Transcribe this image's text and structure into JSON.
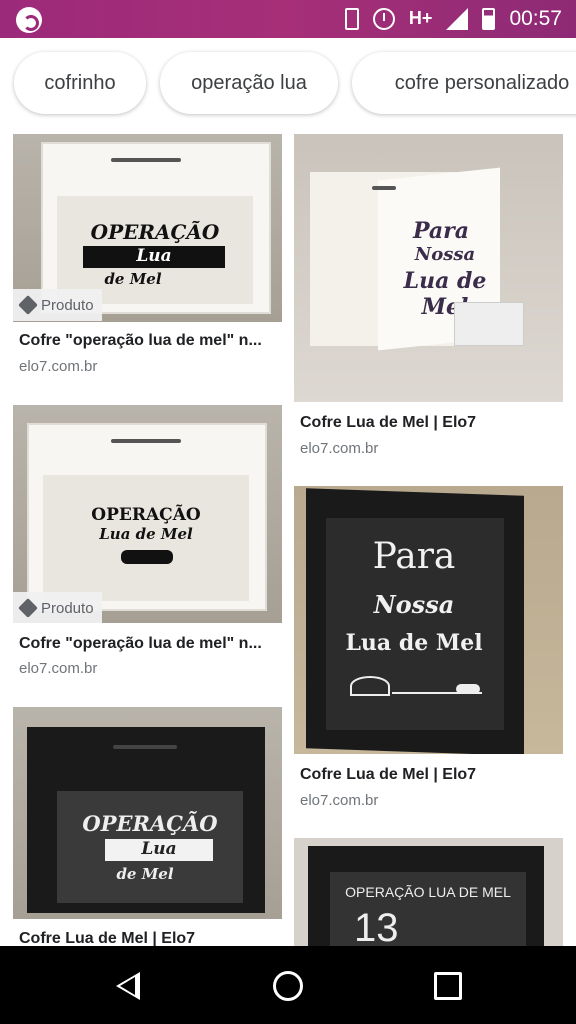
{
  "status_bar": {
    "network": "H+",
    "time": "00:57"
  },
  "chips": [
    "cofrinho",
    "operação lua",
    "cofre personalizado"
  ],
  "results": {
    "left": [
      {
        "caption": "Cofre \"operação lua de mel\" n...",
        "source": "elo7.com.br",
        "badge": "Produto",
        "art": {
          "line1": "OPERAÇÃO",
          "line2": "Lua",
          "line3": "de Mel"
        }
      },
      {
        "caption": "Cofre \"operação lua de mel\" n...",
        "source": "elo7.com.br",
        "badge": "Produto",
        "art": {
          "line1": "OPERAÇÃO",
          "line2": "Lua de Mel"
        }
      },
      {
        "caption": "Cofre Lua de Mel | Elo7",
        "source": "",
        "art": {
          "line1": "OPERAÇÃO",
          "line2": "Lua",
          "line3": "de Mel"
        }
      }
    ],
    "right": [
      {
        "caption": "Cofre Lua de Mel | Elo7",
        "source": "elo7.com.br",
        "art": {
          "line1": "Para",
          "line2": "Nossa",
          "line3": "Lua de",
          "line4": "Mel"
        }
      },
      {
        "caption": "Cofre Lua de Mel | Elo7",
        "source": "elo7.com.br",
        "art": {
          "line1": "Para",
          "line2": "Nossa",
          "line3": "Lua de Mel"
        }
      },
      {
        "caption": "",
        "source": "",
        "art": {
          "line1": "OPERAÇÃO LUA DE MEL",
          "line2": "13"
        }
      }
    ]
  },
  "colors": {
    "status_bar": "#9c2a7a",
    "chip_text": "#3c4043",
    "caption": "#202124",
    "source": "#70757a"
  }
}
